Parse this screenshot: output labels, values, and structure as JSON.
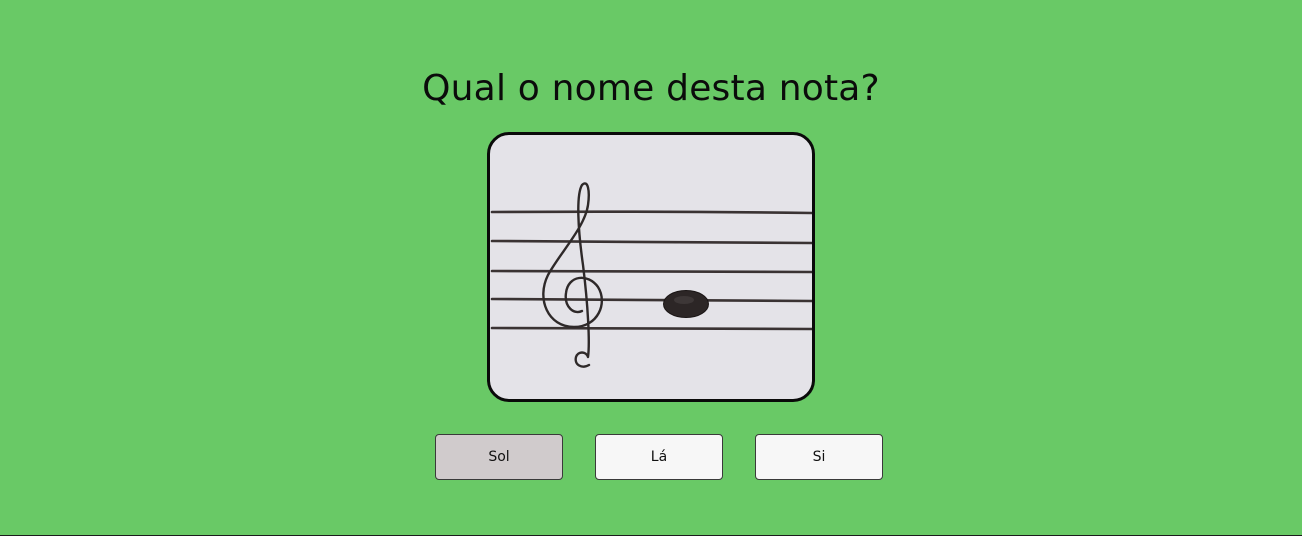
{
  "quiz": {
    "question": "Qual o nome desta nota?",
    "options": [
      {
        "label": "Sol",
        "selected": true
      },
      {
        "label": "Lá",
        "selected": false
      },
      {
        "label": "Si",
        "selected": false
      }
    ]
  },
  "image": {
    "icon": "treble-clef-staff-note",
    "note_position": "second line from bottom"
  },
  "colors": {
    "background": "#69c966",
    "card": "#e4e3e8",
    "button": "#f7f7f7",
    "button_selected": "#d0cbcc",
    "ink": "#2b2626"
  }
}
